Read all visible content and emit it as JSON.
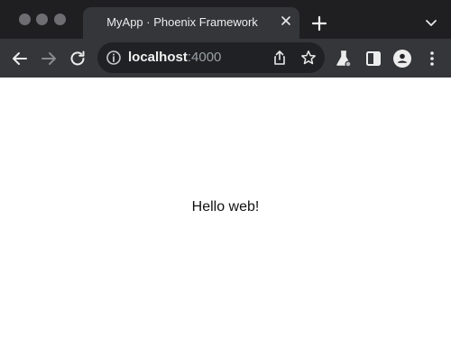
{
  "window": {
    "traffic_lights": [
      "close",
      "minimize",
      "zoom"
    ]
  },
  "tab": {
    "title": "MyApp · Phoenix Framework",
    "close_icon": "close-icon"
  },
  "tabstrip": {
    "new_tab_icon": "plus-icon",
    "tab_search_icon": "chevron-down-icon"
  },
  "toolbar": {
    "back_icon": "arrow-left-icon",
    "forward_icon": "arrow-right-icon",
    "reload_icon": "reload-icon",
    "share_icon": "share-icon",
    "bookmark_icon": "star-icon",
    "labs_icon": "flask-icon",
    "side_panel_icon": "side-panel-icon",
    "profile_icon": "profile-icon",
    "menu_icon": "more-vertical-icon"
  },
  "address_bar": {
    "host": "localhost",
    "port": ":4000",
    "site_info_icon": "info-icon"
  },
  "page": {
    "body_text": "Hello web!"
  },
  "colors": {
    "tabstrip_bg": "#1f1f22",
    "toolbar_bg": "#35363a",
    "omnibox_bg": "#202124",
    "page_bg": "#ffffff"
  }
}
